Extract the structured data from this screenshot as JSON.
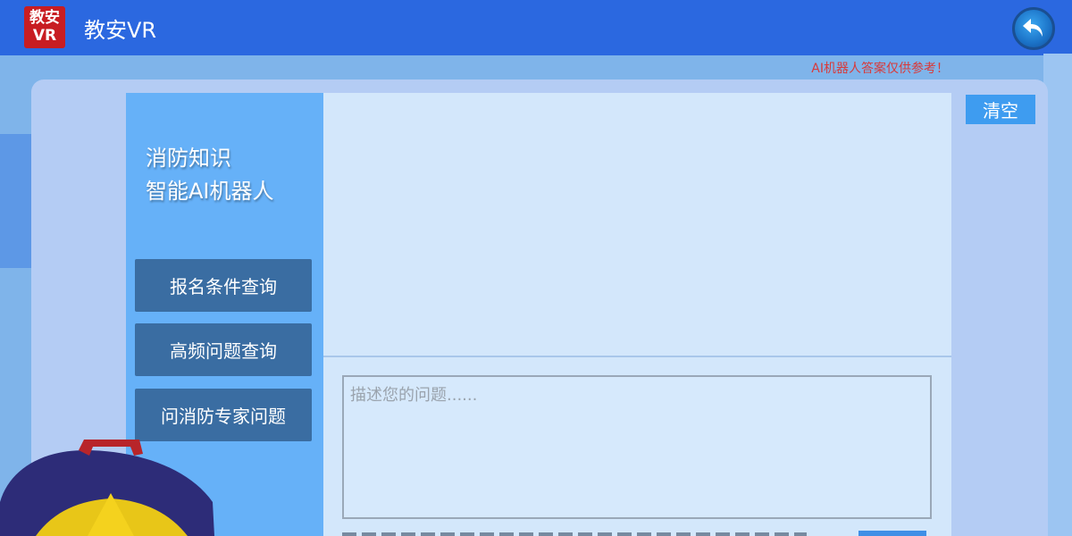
{
  "header": {
    "logo_line1": "教安",
    "logo_line2": "VR",
    "title": "教安VR",
    "back_icon": "undo-arrow-icon"
  },
  "disclaimer": "AI机器人答案仅供参考！",
  "sidebar": {
    "heading_line1": "消防知识",
    "heading_line2": "智能AI机器人",
    "buttons": [
      {
        "label": "报名条件查询"
      },
      {
        "label": "高频问题查询"
      },
      {
        "label": "问消防专家问题"
      }
    ]
  },
  "chat": {
    "clear_label": "清空",
    "input_value": "",
    "input_placeholder": "描述您的问题......"
  },
  "colors": {
    "header": "#2b68e0",
    "sidebar": "#66b1f8",
    "button": "#3a6da2",
    "accent": "#3e9cf0",
    "warning": "#d83a3a"
  }
}
